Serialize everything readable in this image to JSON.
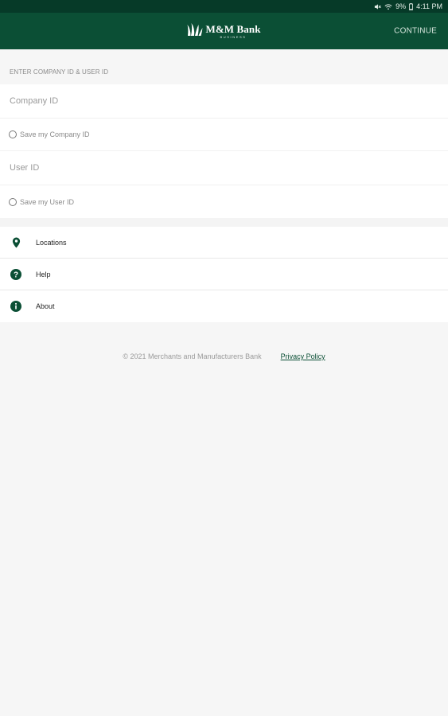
{
  "status_bar": {
    "battery_percent": "9%",
    "time": "4:11 PM",
    "icons": [
      "mute-icon",
      "wifi-icon",
      "battery-icon"
    ]
  },
  "header": {
    "logo_name": "M&M Bank",
    "logo_subtitle": "BUSINESS",
    "continue_label": "CONTINUE"
  },
  "login": {
    "section_label": "ENTER COMPANY ID & USER ID",
    "company_id_placeholder": "Company ID",
    "company_id_value": "",
    "save_company_label": "Save my Company ID",
    "save_company_checked": false,
    "user_id_placeholder": "User ID",
    "user_id_value": "",
    "save_user_label": "Save my User ID",
    "save_user_checked": false
  },
  "menu": {
    "items": [
      {
        "label": "Locations",
        "icon": "location-pin-icon"
      },
      {
        "label": "Help",
        "icon": "help-icon"
      },
      {
        "label": "About",
        "icon": "info-icon"
      }
    ]
  },
  "footer": {
    "copyright": "© 2021 Merchants and Manufacturers Bank",
    "privacy_label": "Privacy Policy"
  },
  "colors": {
    "brand": "#0b4f35",
    "status_bar": "#063a28",
    "background": "#f6f6f6"
  }
}
